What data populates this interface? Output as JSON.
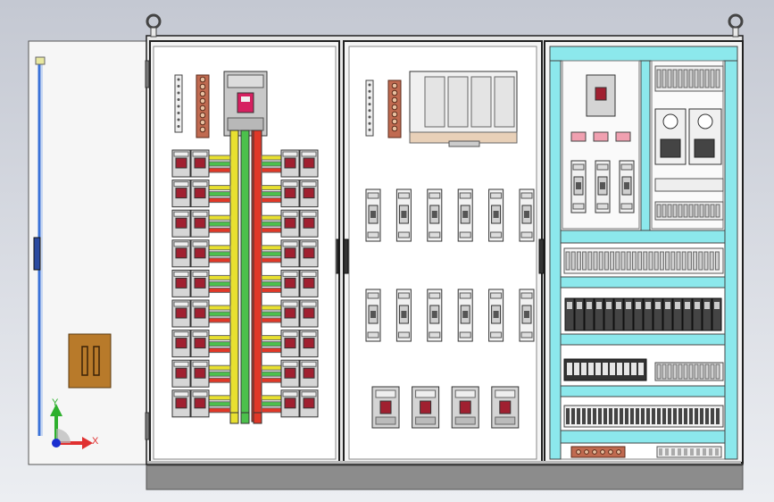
{
  "scene": {
    "background_colors": [
      "#c4c8d2",
      "#eceef2"
    ]
  },
  "axis_triad": {
    "x_label": "X",
    "y_label": "Y",
    "x_color": "#e03030",
    "y_color": "#2eb02e",
    "origin_color": "#1a2fd0"
  },
  "cabinet": {
    "body_color": "#f4f4f4",
    "outline_color": "#202020",
    "plinth_color": "#8c8c8c",
    "lifting_eye_color": "#e8e8e8"
  },
  "door": {
    "hinge_strip_color": "#3a72d8",
    "gland_plate_color": "#b87a2a"
  },
  "section1": {
    "breaker_rows": 9,
    "breakers_per_side": 2,
    "busbar_colors": [
      "#e8e030",
      "#4cc04c",
      "#e03828",
      "#e03828"
    ],
    "main_breaker_label_color": "#d62060"
  },
  "section2": {
    "fuse_rows": 2,
    "fuses_per_row": 6,
    "bottom_breakers": 4
  },
  "section3": {
    "trunking_color": "#8ce8ec",
    "relay_count": 16,
    "indicator_color": "#f0a0b0"
  }
}
